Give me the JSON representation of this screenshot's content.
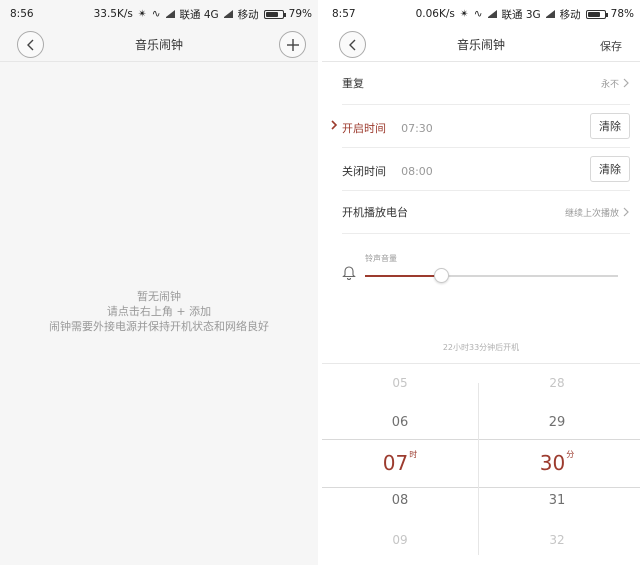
{
  "left": {
    "status": {
      "time": "8:56",
      "speed": "33.5K/s",
      "net1": "联通 4G",
      "net2": "移动",
      "battery": "79%",
      "battery_level": 0.79
    },
    "title": "音乐闹钟",
    "empty_lines": [
      "暂无闹钟",
      "请点击右上角 + 添加",
      "闹钟需要外接电源并保持开机状态和网络良好"
    ]
  },
  "right": {
    "status": {
      "time": "8:57",
      "speed": "0.06K/s",
      "net1": "联通 3G",
      "net2": "移动",
      "battery": "78%",
      "battery_level": 0.78
    },
    "title": "音乐闹钟",
    "save_label": "保存",
    "repeat": {
      "label": "重复",
      "value": "永不"
    },
    "on_time": {
      "label": "开启时间",
      "time": "07:30",
      "clear_label": "清除"
    },
    "off_time": {
      "label": "关闭时间",
      "time": "08:00",
      "clear_label": "清除"
    },
    "startup": {
      "label": "开机播放电台",
      "value": "继续上次播放"
    },
    "volume": {
      "label": "铃声音量",
      "level": 0.3
    },
    "countdown": "22小时33分钟后开机",
    "picker": {
      "hours": [
        "05",
        "06",
        "07",
        "08",
        "09"
      ],
      "hour_unit": "时",
      "minutes": [
        "28",
        "29",
        "30",
        "31",
        "32"
      ],
      "minute_unit": "分"
    }
  },
  "colors": {
    "accent": "#9c3b2e",
    "muted": "#999999",
    "divider": "#ececec"
  }
}
